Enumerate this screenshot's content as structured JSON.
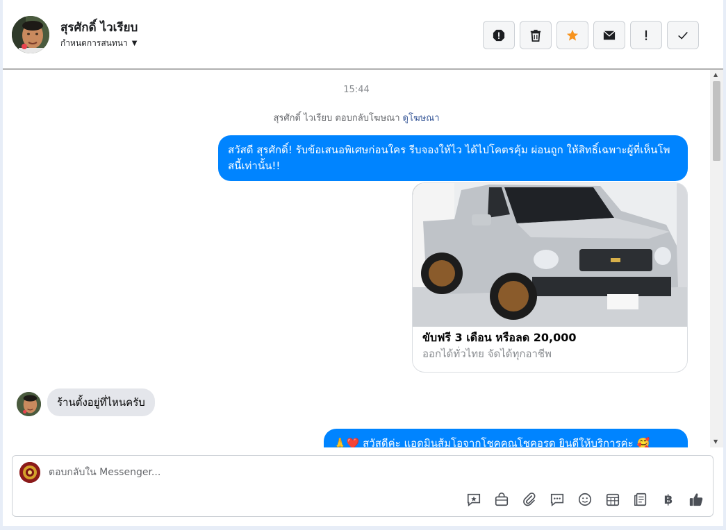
{
  "header": {
    "contact_name": "สุรศักดิ์ ไวเรียบ",
    "conversation_settings": "กำหนดการสนทนา",
    "actions": [
      "report-icon",
      "trash-icon",
      "star-icon",
      "envelope-icon",
      "exclamation-icon",
      "check-icon"
    ],
    "star_color": "#f7931e"
  },
  "chat": {
    "timestamp": "15:44",
    "ad_reply_text": "สุรศักดิ์ ไวเรียบ ตอบกลับโฆษณา",
    "ad_reply_link": "ดูโฆษณา",
    "messages": [
      {
        "from": "page",
        "text": "สวัสดี สุรศักดิ์! รับข้อเสนอพิเศษก่อนใคร รีบจองให้ไว ได้ไปโคตรคุ้ม ผ่อนถูก ให้สิทธิ์เฉพาะผู้ที่เห็นโพสนี้เท่านั้น!!"
      },
      {
        "from": "page",
        "card": {
          "title": "ขับฟรี 3 เดือน หรือลด 20,000",
          "subtitle": "ออกได้ทั่วไทย จัดได้ทุกอาชีพ"
        }
      },
      {
        "from": "user",
        "text": "ร้านตั้งอยู่ที่ไหนครับ"
      },
      {
        "from": "page",
        "text": "🙏❤️ สวัสดีค่ะ แอดมินส้มโอจากโชคคูณโชคอรด ยินดีให้บริการค่ะ 🥰"
      }
    ],
    "bubble_color": "#0084ff"
  },
  "composer": {
    "placeholder": "ตอบกลับใน Messenger...",
    "tools": [
      "chat-star-icon",
      "shopping-bag-icon",
      "paperclip-icon",
      "saved-reply-icon",
      "emoji-icon",
      "calendar-grid-icon",
      "notes-icon",
      "baht-icon",
      "thumbs-up-icon"
    ],
    "baht_symbol": "฿"
  }
}
